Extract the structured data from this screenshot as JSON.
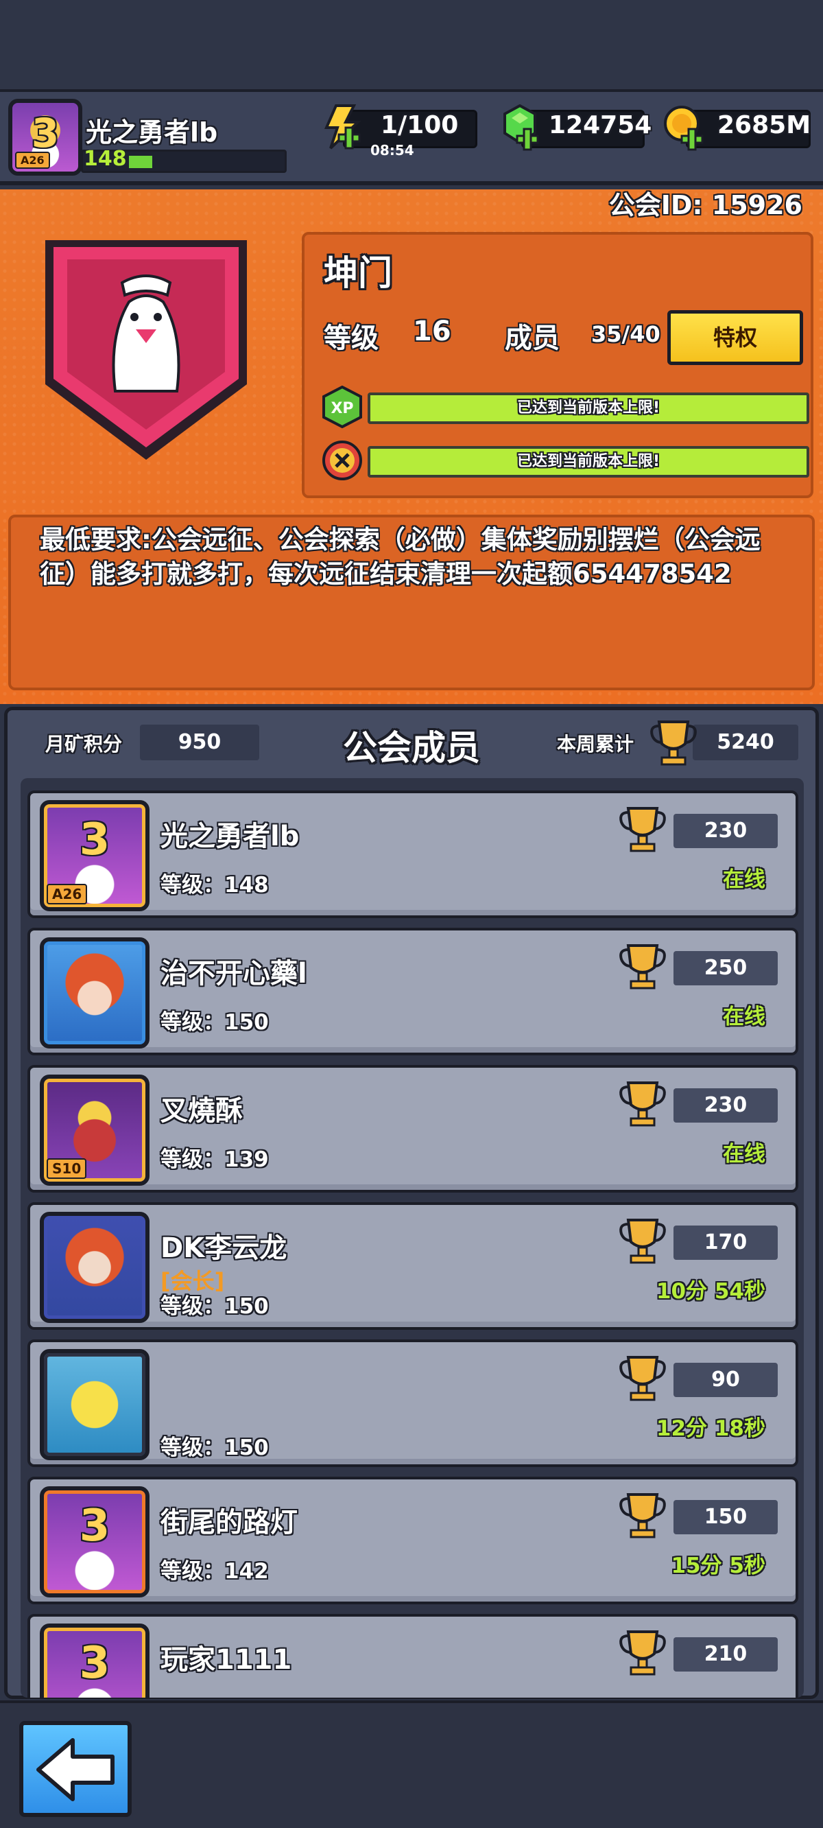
{
  "player": {
    "name": "光之勇者lb",
    "level": "148",
    "avatar_number": "3",
    "avatar_tag": "A26"
  },
  "resources": {
    "energy": "1/100",
    "energy_timer": "08:54",
    "gems": "124754",
    "coins": "2685M"
  },
  "guild": {
    "id_text": "公会ID: 15926",
    "name": "坤门",
    "level_label": "等级",
    "level": "16",
    "members_label": "成员",
    "members": "35/40",
    "perk_button": "特权",
    "xp_progress_text": "已达到当前版本上限!",
    "tech_progress_text": "已达到当前版本上限!",
    "xp_icon_text": "XP",
    "requirements": "最低要求:公会远征、公会探索（必做）集体奖励别摆烂（公会远征）能多打就多打，每次远征结束清理一次起额654478542"
  },
  "members_panel": {
    "title": "公会成员",
    "mine_label": "月矿积分",
    "mine_value": "950",
    "week_label": "本周累计",
    "week_value": "5240",
    "level_prefix": "等级：",
    "members": [
      {
        "name": "光之勇者lb",
        "role": "",
        "level": "148",
        "trophies": "230",
        "status": "在线",
        "avatar_tag": "A26"
      },
      {
        "name": "治不开心藥l",
        "role": "",
        "level": "150",
        "trophies": "250",
        "status": "在线",
        "avatar_tag": ""
      },
      {
        "name": "叉燒酥",
        "role": "",
        "level": "139",
        "trophies": "230",
        "status": "在线",
        "avatar_tag": "S10"
      },
      {
        "name": "DK李云龙",
        "role": "[会长]",
        "level": "150",
        "trophies": "170",
        "status": "10分 54秒",
        "avatar_tag": ""
      },
      {
        "name": "",
        "role": "",
        "level": "150",
        "trophies": "90",
        "status": "12分 18秒",
        "avatar_tag": ""
      },
      {
        "name": "街尾的路灯",
        "role": "",
        "level": "142",
        "trophies": "150",
        "status": "15分 5秒",
        "avatar_tag": ""
      },
      {
        "name": "玩家1111",
        "role": "",
        "level": "",
        "trophies": "210",
        "status": "",
        "avatar_tag": ""
      }
    ]
  },
  "colors": {
    "orange_bg": "#ec7326",
    "accent_green": "#b6ee3a",
    "leader_orange": "#f39a24",
    "back_blue": "#3aa3f2"
  }
}
